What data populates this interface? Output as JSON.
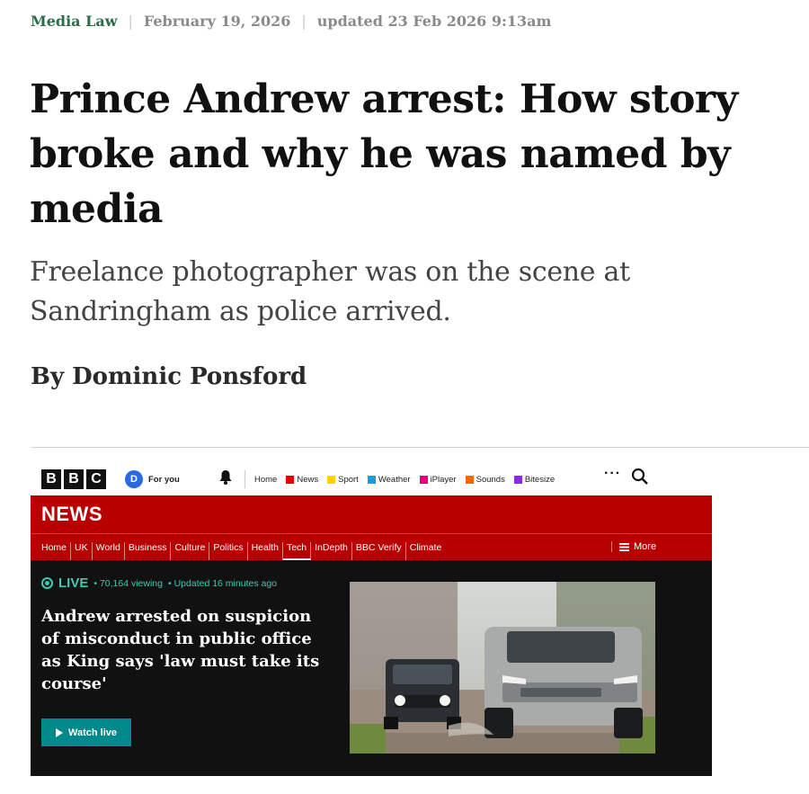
{
  "article": {
    "category": "Media Law",
    "date": "February 19, 2026",
    "updated": "updated 23 Feb 2026 9:13am",
    "headline": "Prince Andrew arrest: How story broke and why he was named by media",
    "standfirst": "Freelance photographer was on the scene at Sandringham as police arrived.",
    "byline": "By Dominic Ponsford"
  },
  "bbc": {
    "logo_letters": [
      "B",
      "B",
      "C"
    ],
    "for_you_badge": "D",
    "for_you_label": "For you",
    "nav": [
      {
        "label": "Home",
        "color": ""
      },
      {
        "label": "News",
        "color": "#e60000"
      },
      {
        "label": "Sport",
        "color": "#ffd200"
      },
      {
        "label": "Weather",
        "color": "#1a9ed9"
      },
      {
        "label": "iPlayer",
        "color": "#e6007e"
      },
      {
        "label": "Sounds",
        "color": "#ff6600"
      },
      {
        "label": "Bitesize",
        "color": "#8a2be2"
      }
    ],
    "more_dots": "···",
    "news_wordmark": "NEWS",
    "sections": [
      "Home",
      "UK",
      "World",
      "Business",
      "Culture",
      "Politics",
      "Health",
      "Tech",
      "InDepth",
      "BBC Verify",
      "Climate"
    ],
    "active_section": "Tech",
    "more_label": "More",
    "live_label": "LIVE",
    "viewing": "• 70,164 viewing",
    "updated": "• Updated 16 minutes ago",
    "story_headline": "Andrew arrested on suspicion of misconduct in public office as King says 'law must take its course'",
    "watch_label": "Watch live",
    "colors": {
      "brand_red": "#b80000",
      "live_teal": "#3ec9b0",
      "watch_button": "#00898a",
      "dark_bg": "#111111"
    }
  }
}
